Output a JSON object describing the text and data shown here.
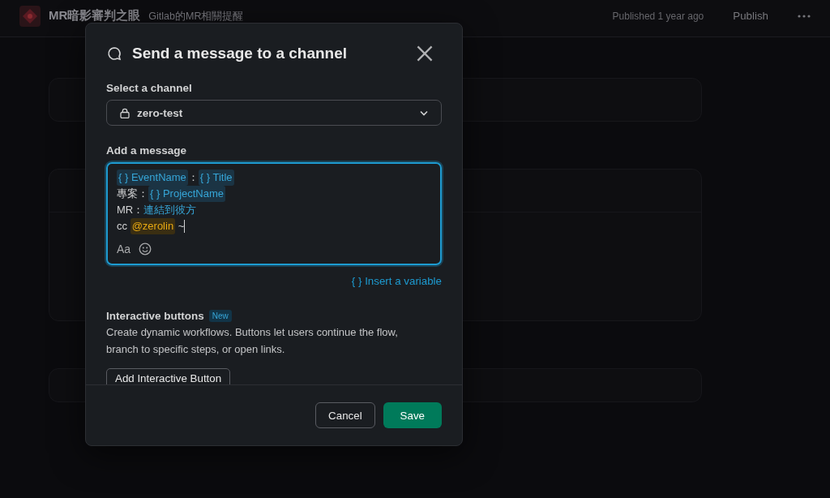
{
  "header": {
    "title": "MR暗影審判之眼",
    "subtitle": "Gitlab的MR相關提醒",
    "status": "Published 1 year ago",
    "publish_button": "Publish"
  },
  "dialog": {
    "title": "Send a message to a channel",
    "channel_label": "Select a channel",
    "channel": "zero-test",
    "message_label": "Add a message",
    "message_lines": [
      [
        {
          "kind": "variable",
          "text": "{ } EventName"
        },
        {
          "kind": "text",
          "text": "："
        },
        {
          "kind": "variable",
          "text": "{ } Title"
        }
      ],
      [
        {
          "kind": "text",
          "text": "專案："
        },
        {
          "kind": "variable",
          "text": "{ } ProjectName"
        }
      ],
      [
        {
          "kind": "text",
          "text": "MR："
        },
        {
          "kind": "link",
          "text": "連結到彼方"
        }
      ],
      [
        {
          "kind": "text",
          "text": "cc "
        },
        {
          "kind": "mention",
          "text": "@zerolin"
        },
        {
          "kind": "text",
          "text": " ~"
        }
      ]
    ],
    "format_button": "Aa",
    "insert_variable": "{ } Insert a variable",
    "section_title": "Interactive buttons",
    "badge": "New",
    "description": "Create dynamic workflows. Buttons let users continue the flow, branch to specific steps, or open links.",
    "add_button": "Add Interactive Button",
    "cancel_button": "Cancel",
    "save_button": "Save"
  }
}
